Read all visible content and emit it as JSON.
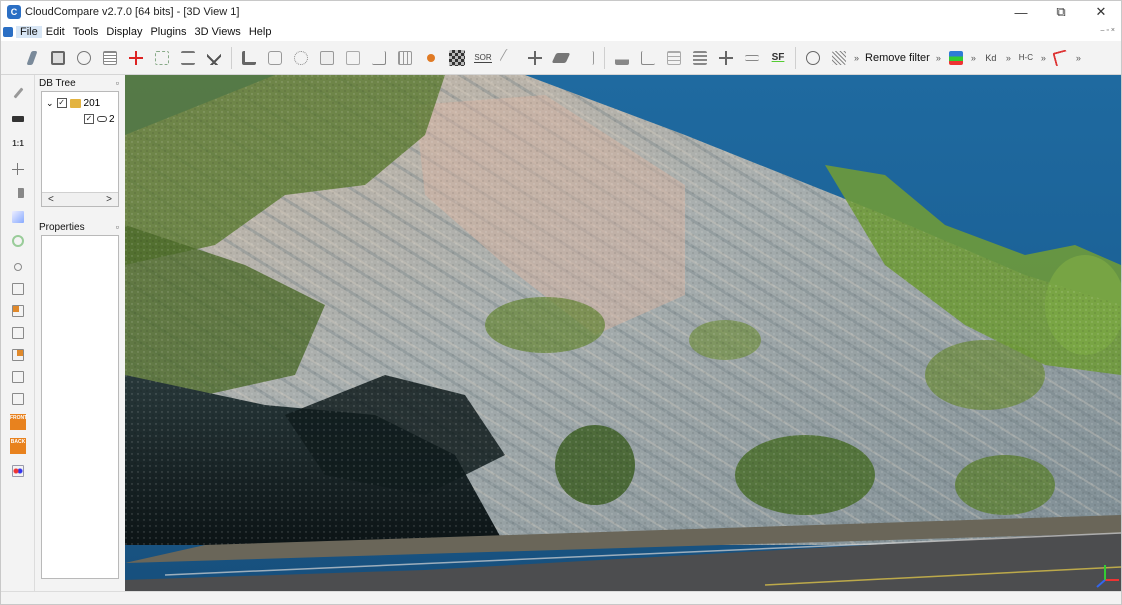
{
  "window": {
    "title": "CloudCompare v2.7.0 [64 bits] - [3D View 1]",
    "app_icon_label": "C",
    "controls": {
      "minimize": "—",
      "restore": "⧉",
      "close": "✕"
    }
  },
  "menu": {
    "items": [
      "File",
      "Edit",
      "Tools",
      "Display",
      "Plugins",
      "3D Views",
      "Help"
    ],
    "mdi_controls": [
      "–",
      "▫",
      "×"
    ]
  },
  "toolbar": {
    "icons": [
      "pencil-icon",
      "save-icon",
      "crosshair-icon",
      "list-icon",
      "translate-icon",
      "sample-icon",
      "segment-icon",
      "delete-icon",
      "merge-icon",
      "register-icon",
      "align-icon",
      "normals-icon",
      "octree-icon",
      "distance-icon",
      "cloud-icon",
      "sor-filter-icon",
      "noise-icon",
      "move-icon",
      "plane-icon",
      "measure-icon",
      "histogram-icon",
      "graph-icon",
      "stats-icon",
      "layers-icon",
      "plus-icon",
      "equal-icon"
    ],
    "sor_label": "SOR",
    "sf_label": "SF",
    "more_glyph": "»",
    "remove_filter_label": "Remove filter",
    "kd_label": "Kd",
    "hc_label": "H-C"
  },
  "db_tree": {
    "title": "DB Tree",
    "float_glyph": "▫",
    "root_label": "201",
    "child_label": "2",
    "expander": "⌄",
    "check_glyph": "✓",
    "scroll_left": "<",
    "scroll_right": ">"
  },
  "properties": {
    "title": "Properties",
    "float_glyph": "▫"
  },
  "left_toolbar": {
    "icons": [
      "pencil-icon",
      "camera-icon",
      "zoom-1to1-icon",
      "plus-icon",
      "perspective-icon",
      "light-icon",
      "pivot-icon",
      "zoom-icon",
      "top-view-icon",
      "front-view-icon",
      "left-view-icon",
      "back-view-icon",
      "right-view-icon",
      "bottom-view-icon",
      "iso-front-icon",
      "iso-back-icon",
      "stereo-icon"
    ],
    "front_label": "FRONT",
    "back_label": "BACK"
  },
  "view": {
    "name": "3D View 1",
    "colors": {
      "sky": "#1f6aa0",
      "rock_light": "#b9b3a6",
      "rock_grey": "#8e9ca3",
      "vegetation": "#6f8c3a",
      "shadow": "#0f1c20",
      "road": "#4c4d4f"
    }
  }
}
